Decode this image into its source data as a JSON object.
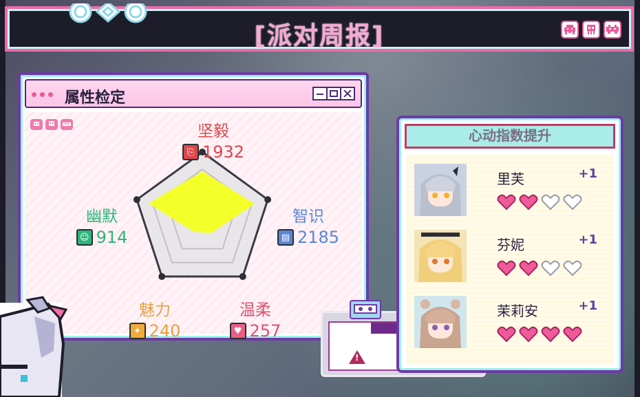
{
  "header": {
    "title": "[派对周报]"
  },
  "attributes": {
    "window_title": "属性检定",
    "stats": [
      {
        "key": "toughness",
        "name": "坚毅",
        "value": "1932",
        "score": 0.72,
        "color": "#d9474a"
      },
      {
        "key": "intellect",
        "name": "智识",
        "value": "2185",
        "score": 0.8,
        "color": "#5b86d6"
      },
      {
        "key": "gentleness",
        "name": "温柔",
        "value": "257",
        "score": 0.22,
        "color": "#d9526f"
      },
      {
        "key": "charm",
        "name": "魅力",
        "value": "240",
        "score": 0.2,
        "color": "#e8a040"
      },
      {
        "key": "humor",
        "name": "幽默",
        "value": "914",
        "score": 0.82,
        "color": "#2fb57a"
      }
    ]
  },
  "affection": {
    "title": "心动指数提升",
    "characters": [
      {
        "name": "里芙",
        "gain": "+1",
        "hearts_filled": 2,
        "hearts_total": 4
      },
      {
        "name": "芬妮",
        "gain": "+1",
        "hearts_filled": 2,
        "hearts_total": 4
      },
      {
        "name": "茉莉安",
        "gain": "+1",
        "hearts_filled": 4,
        "hearts_total": 4
      }
    ]
  },
  "colors": {
    "accent_pink": "#ee6aa8",
    "accent_cyan": "#9df0ec",
    "accent_purple": "#6c3aa6",
    "radar_fill": "#f4ff2a"
  }
}
